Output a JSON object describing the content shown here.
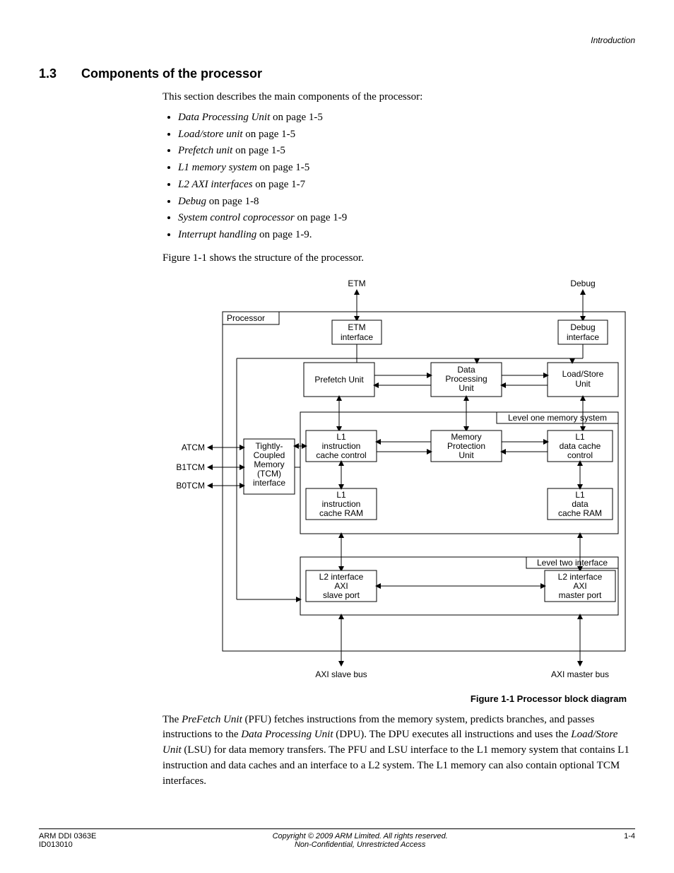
{
  "header": {
    "section_label": "Introduction"
  },
  "heading": {
    "number": "1.3",
    "title": "Components of the processor"
  },
  "intro": "This section describes the main components of the processor:",
  "bullets": [
    {
      "name": "Data Processing Unit",
      "tail": " on page 1-5"
    },
    {
      "name": "Load/store unit",
      "tail": " on page 1-5"
    },
    {
      "name": "Prefetch unit",
      "tail": " on page 1-5"
    },
    {
      "name": "L1 memory system",
      "tail": " on page 1-5"
    },
    {
      "name": "L2 AXI interfaces",
      "tail": " on page 1-7"
    },
    {
      "name": "Debug",
      "tail": " on page 1-8"
    },
    {
      "name": "System control coprocessor",
      "tail": " on page 1-9"
    },
    {
      "name": "Interrupt handling",
      "tail": " on page 1-9."
    }
  ],
  "fig_intro": "Figure 1-1 shows the structure of the processor.",
  "figure": {
    "caption": "Figure 1-1 Processor block diagram",
    "top_labels": {
      "etm": "ETM",
      "debug": "Debug"
    },
    "processor_label": "Processor",
    "boxes": {
      "etm_interface": "ETM\ninterface",
      "debug_interface": "Debug\ninterface",
      "prefetch_unit": "Prefetch Unit",
      "dpu": "Data\nProcessing\nUnit",
      "lsu": "Load/Store\nUnit",
      "l1_sys_label": "Level one memory system",
      "l1_ic_ctrl": "L1\ninstruction\ncache control",
      "mpu": "Memory\nProtection\nUnit",
      "l1_dc_ctrl": "L1\ndata cache\ncontrol",
      "tcm": "Tightly-\nCoupled\nMemory\n(TCM)\ninterface",
      "l1_ic_ram": "L1\ninstruction\ncache RAM",
      "l1_dc_ram": "L1\ndata\ncache RAM",
      "l2_label": "Level two interface",
      "l2_slave": "L2 interface\nAXI\nslave port",
      "l2_master": "L2 interface\nAXI\nmaster port"
    },
    "side_labels": {
      "atcm": "ATCM",
      "b1tcm": "B1TCM",
      "b0tcm": "B0TCM"
    },
    "bottom_labels": {
      "axi_slave": "AXI slave bus",
      "axi_master": "AXI master bus"
    }
  },
  "body_para": {
    "t1": "The ",
    "i1": "PreFetch Unit",
    "t2": " (PFU) fetches instructions from the memory system, predicts branches, and passes instructions to the ",
    "i2": "Data Processing Unit",
    "t3": " (DPU). The DPU executes all instructions and uses the ",
    "i3": "Load/Store Unit",
    "t4": " (LSU) for data memory transfers. The PFU and LSU interface to the L1 memory system that contains L1 instruction and data caches and an interface to a L2 system. The L1 memory can also contain optional TCM interfaces."
  },
  "footer": {
    "doc_id1": "ARM DDI 0363E",
    "doc_id2": "ID013010",
    "copyright": "Copyright © 2009 ARM Limited. All rights reserved.",
    "conf": "Non-Confidential, Unrestricted Access",
    "page": "1-4"
  }
}
